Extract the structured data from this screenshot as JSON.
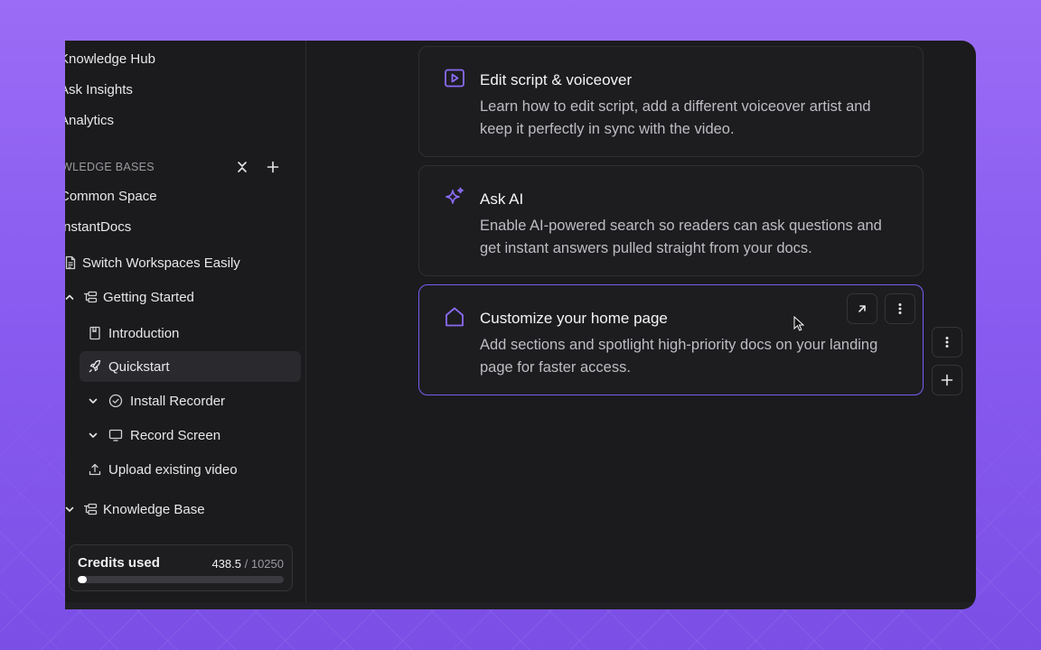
{
  "sidebar": {
    "top_items": [
      "Knowledge Hub",
      "Ask Insights",
      "Analytics"
    ],
    "section_title": "KNOWLEDGE BASES",
    "section_title_visible": "WLEDGE BASES",
    "spaces": [
      "Common Space",
      "InstantDocs"
    ],
    "tree": {
      "switch_workspaces": "Switch Workspaces Easily",
      "getting_started": "Getting Started",
      "introduction": "Introduction",
      "quickstart": "Quickstart",
      "install_recorder": "Install Recorder",
      "record_screen": "Record Screen",
      "upload_video": "Upload existing video",
      "knowledge_base": "Knowledge Base"
    },
    "active_item": "Quickstart"
  },
  "credits": {
    "label": "Credits used",
    "used": "438.5",
    "separator": " / ",
    "total": "10250",
    "fraction": 0.0428
  },
  "cards": [
    {
      "title": "Edit script & voiceover",
      "description": "Learn how to edit script, add a different voiceover artist and keep it perfectly in sync with the video.",
      "icon": "play-square-icon"
    },
    {
      "title": "Ask AI",
      "description": "Enable AI-powered search so readers can ask questions and get instant answers pulled straight from your docs.",
      "icon": "sparkle-icon"
    },
    {
      "title": "Customize your home page",
      "description": "Add sections and spotlight high-priority docs on your landing page for faster access.",
      "icon": "home-icon",
      "selected": true
    }
  ],
  "colors": {
    "accent": "#7b5cf0",
    "background": "#1b1b1d",
    "sidebar_active": "#2a2a2e",
    "page_gradient_top": "#9b6cf5"
  }
}
